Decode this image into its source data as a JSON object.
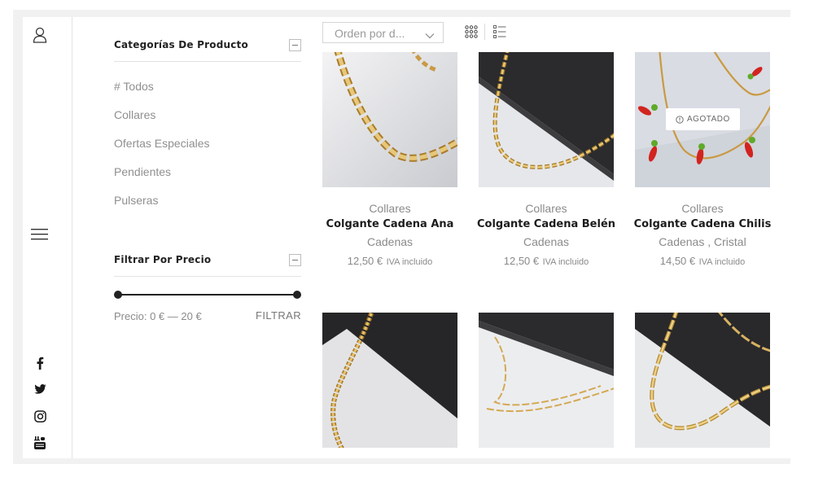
{
  "sidebar": {
    "categories_title": "Categorías De Producto",
    "categories": [
      "# Todos",
      "Collares",
      "Ofertas Especiales",
      "Pendientes",
      "Pulseras"
    ],
    "price_title": "Filtrar Por Precio",
    "price_label": "Precio: 0 € — 20 €",
    "filter_button": "FILTRAR",
    "price_range": {
      "min": 0,
      "max": 20,
      "selected_min": 0,
      "selected_max": 20
    }
  },
  "toolbar": {
    "sort_value": "Orden por d..."
  },
  "rail_icons": [
    "user-icon",
    "menu-icon",
    "facebook-icon",
    "twitter-icon",
    "instagram-icon",
    "youtube-icon"
  ],
  "products": [
    {
      "category": "Collares",
      "name": "Colgante Cadena Ana",
      "sub": "Cadenas",
      "price": "12,50 €",
      "tax": "IVA incluido",
      "badge": ""
    },
    {
      "category": "Collares",
      "name": "Colgante Cadena Belén",
      "sub": "Cadenas",
      "price": "12,50 €",
      "tax": "IVA incluido",
      "badge": ""
    },
    {
      "category": "Collares",
      "name": "Colgante Cadena Chilis",
      "sub": "Cadenas , Cristal",
      "price": "14,50 €",
      "tax": "IVA incluido",
      "badge": "AGOTADO"
    }
  ],
  "colors": {
    "accent": "#222222",
    "muted_text": "#8a8a8a",
    "gold": "#c9a24b",
    "slate": "#2a2a2a"
  }
}
